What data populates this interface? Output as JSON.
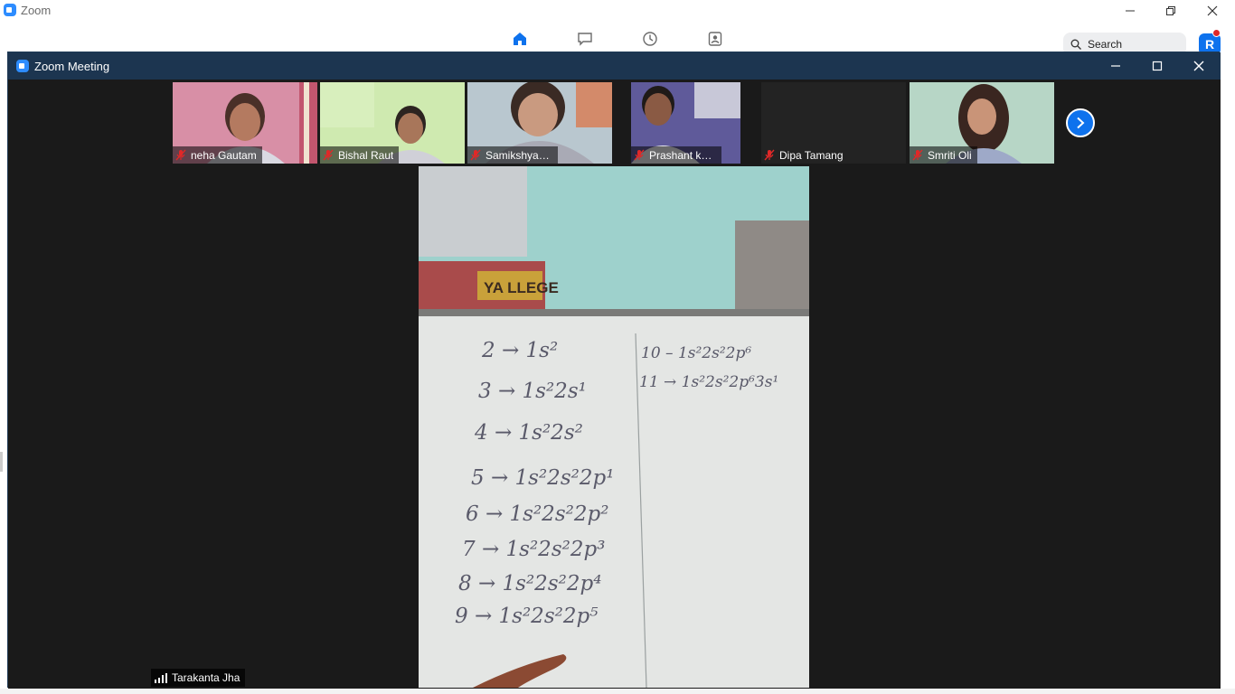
{
  "app": {
    "title": "Zoom",
    "search_label": "Search",
    "avatar_letter": "R",
    "nav_icons": [
      "home-icon",
      "chat-icon",
      "clock-icon",
      "contacts-icon"
    ],
    "accent": "#0e72ed"
  },
  "meeting": {
    "title": "Zoom Meeting",
    "active_speaker": "Tarakanta Jha",
    "participants": [
      {
        "name": "neha Gautam",
        "muted": true
      },
      {
        "name": "Bishal Raut",
        "muted": true
      },
      {
        "name": "Samikshya giri",
        "muted": true
      },
      {
        "name": "Prashant kha...",
        "muted": true
      },
      {
        "name": "Dipa Tamang",
        "muted": true
      },
      {
        "name": "Smriti Oli",
        "muted": true
      }
    ]
  },
  "whiteboard": {
    "left_column": [
      "2 → 1s²",
      "3 → 1s²2s¹",
      "4 → 1s²2s²",
      "5 → 1s²2s²2p¹",
      "6 → 1s²2s²2p²",
      "7 → 1s²2s²2p³",
      "8 → 1s²2s²2p⁴",
      "9 → 1s²2s²2p⁵"
    ],
    "right_column": [
      "10 – 1s²2s²2p⁶",
      "11 → 1s²2s²2p⁶3s¹"
    ],
    "poster_text": "YA LLEGE"
  }
}
